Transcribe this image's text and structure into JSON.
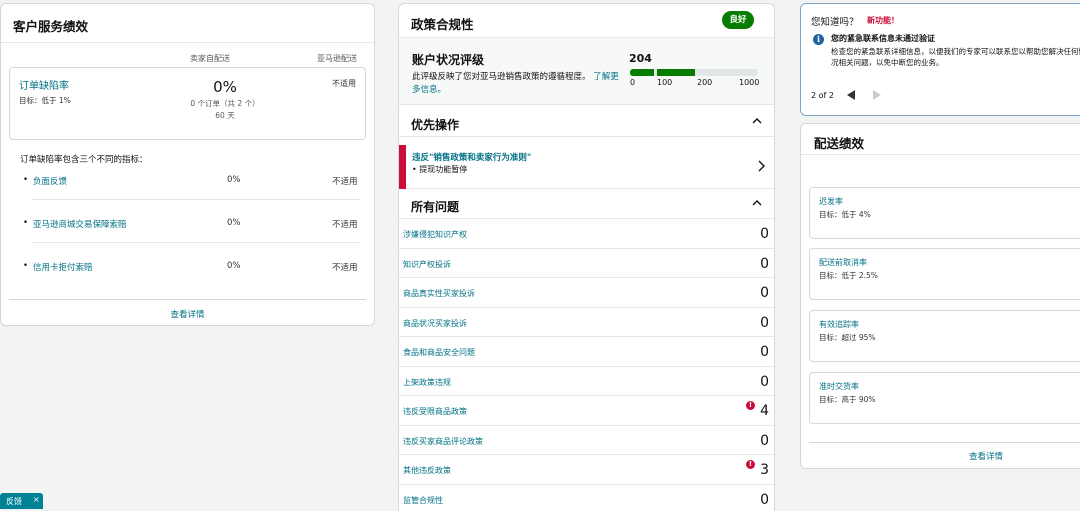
{
  "customer_service": {
    "title": "客户服务绩效",
    "col_seller": "卖家自配送",
    "col_amazon": "亚马逊配送",
    "odr": {
      "name": "订单缺陷率",
      "target": "目标：低于 1%",
      "pct": "0%",
      "detail": "0 个订单（共 2 个）",
      "days": "60 天",
      "amazon": "不适用"
    },
    "intro": "订单缺陷率包含三个不同的指标：",
    "sub_metrics": [
      {
        "name": "负面反馈",
        "pct": "0%",
        "amazon": "不适用"
      },
      {
        "name": "亚马逊商城交易保障索赔",
        "pct": "0%",
        "amazon": "不适用"
      },
      {
        "name": "信用卡拒付索赔",
        "pct": "0%",
        "amazon": "不适用"
      }
    ],
    "view_details": "查看详情"
  },
  "policy": {
    "title": "政策合规性",
    "badge": "良好",
    "ahr": {
      "title": "账户状况评级",
      "desc": "此评级反映了您对亚马逊销售政策的遵循程度。",
      "learn_more": "了解更多信息。",
      "score": "204",
      "score_value": 204,
      "scale_max": 1000,
      "ticks": [
        "0",
        "100",
        "200",
        "1000"
      ]
    },
    "priority_label": "优先操作",
    "priority_item": {
      "title": "违反\"销售政策和卖家行为准则\"",
      "sub": "• 提现功能暂停"
    },
    "all_issues_label": "所有问题",
    "issues": [
      {
        "name": "涉嫌侵犯知识产权",
        "count": "0",
        "alert": false
      },
      {
        "name": "知识产权投诉",
        "count": "0",
        "alert": false
      },
      {
        "name": "商品真实性买家投诉",
        "count": "0",
        "alert": false
      },
      {
        "name": "商品状况买家投诉",
        "count": "0",
        "alert": false
      },
      {
        "name": "食品和商品安全问题",
        "count": "0",
        "alert": false
      },
      {
        "name": "上架政策违规",
        "count": "0",
        "alert": false
      },
      {
        "name": "违反受限商品政策",
        "count": "4",
        "alert": true
      },
      {
        "name": "违反买家商品评论政策",
        "count": "0",
        "alert": false
      },
      {
        "name": "其他违反政策",
        "count": "3",
        "alert": true
      },
      {
        "name": "监管合规性",
        "count": "0",
        "alert": false
      }
    ]
  },
  "did_you_know": {
    "title": "您知道吗？",
    "new_label": "新功能！",
    "headline": "您的紧急联系信息未通过验证",
    "body": "检查您的紧急联系详细信息，以便我们的专家可以联系您以帮助您解决任何情况相关问题，以免中断您的业务。",
    "pager": "2 of 2"
  },
  "shipping": {
    "title": "配送绩效",
    "metrics": [
      {
        "name": "迟发率",
        "target": "目标：低于 4%"
      },
      {
        "name": "配送前取消率",
        "target": "目标：低于 2.5%"
      },
      {
        "name": "有效追踪率",
        "target": "目标：超过 95%"
      },
      {
        "name": "准时交货率",
        "target": "目标：高于 90%"
      }
    ],
    "view_details": "查看详情"
  },
  "feedback": {
    "label": "反馈",
    "close": "×"
  },
  "colors": {
    "link": "#007185",
    "good": "#067d00",
    "alert": "#cc0c39"
  }
}
